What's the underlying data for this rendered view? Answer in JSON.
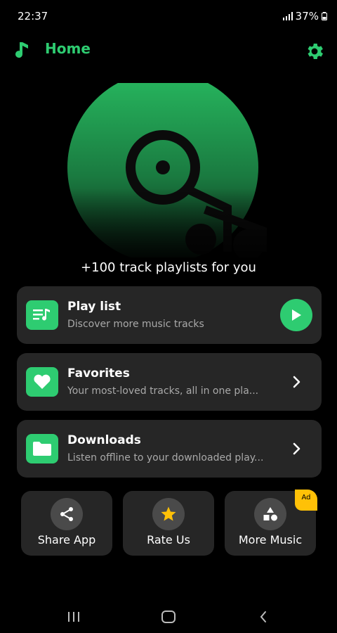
{
  "status": {
    "time": "22:37",
    "battery": "37%"
  },
  "header": {
    "title": "Home"
  },
  "hero": {
    "tagline": "+100 track playlists for you"
  },
  "cards": [
    {
      "title": "Play list",
      "subtitle": "Discover more music tracks"
    },
    {
      "title": "Favorites",
      "subtitle": "Your most-loved tracks, all in one pla..."
    },
    {
      "title": "Downloads",
      "subtitle": "Listen offline to your downloaded play..."
    }
  ],
  "tiles": [
    {
      "label": "Share App",
      "icon": "share-icon"
    },
    {
      "label": "Rate Us",
      "icon": "star-icon"
    },
    {
      "label": "More Music",
      "icon": "shapes-icon",
      "badge": "Ad"
    }
  ],
  "colors": {
    "accent": "#2ecc71",
    "card_bg": "#262626",
    "badge": "#ffc107"
  }
}
